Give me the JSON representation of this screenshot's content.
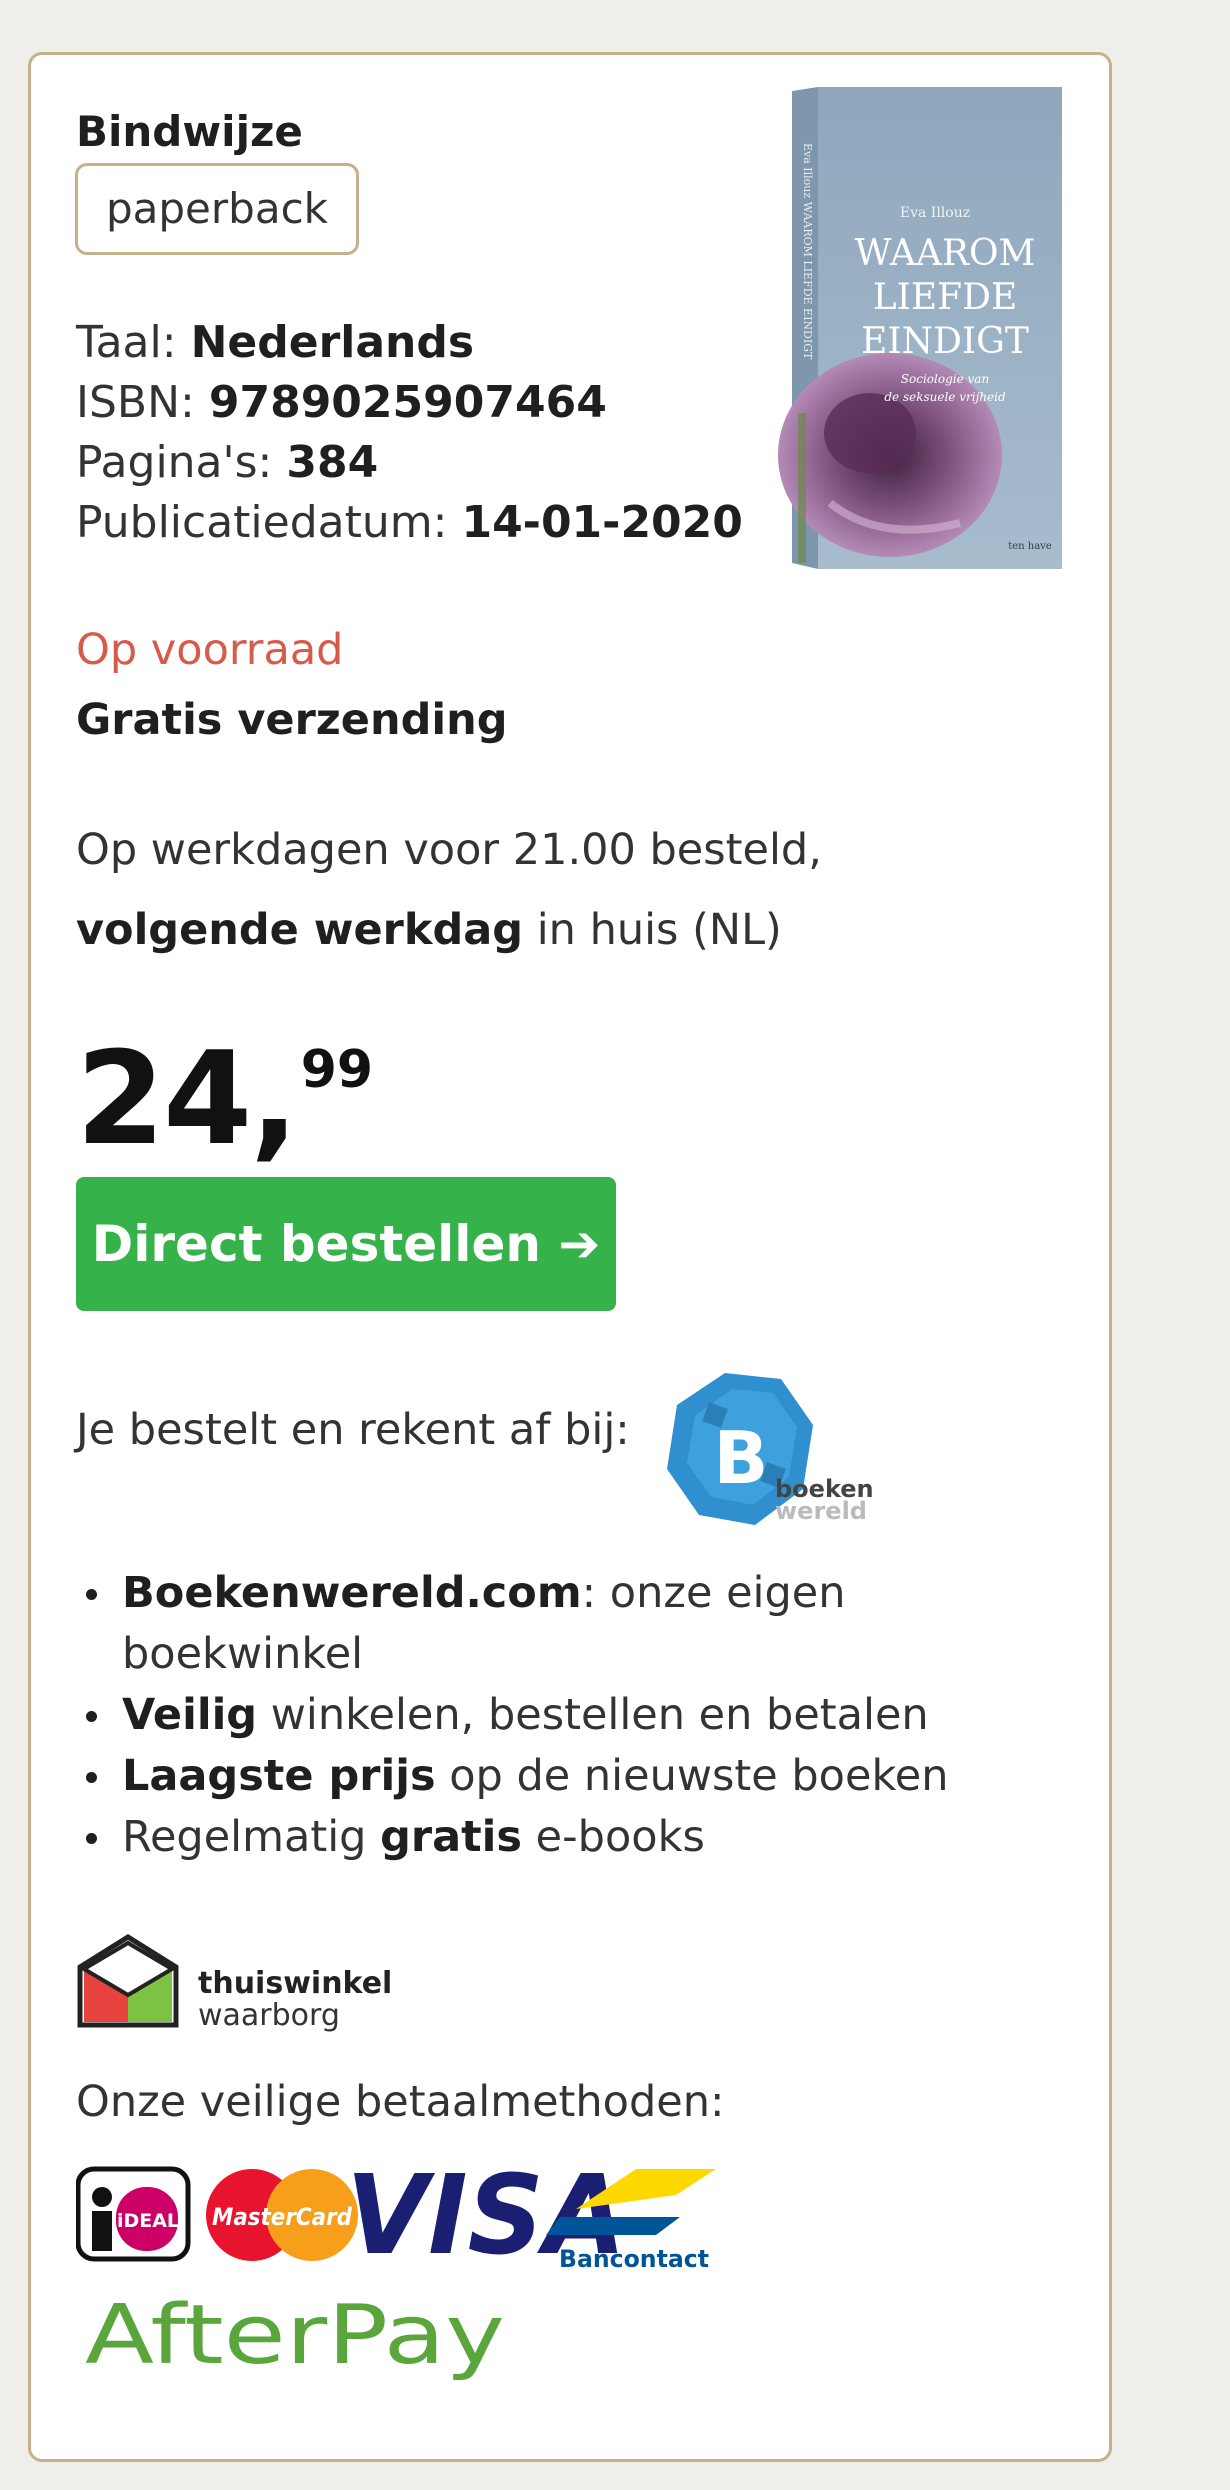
{
  "binding": {
    "heading": "Bindwijze",
    "value": "paperback"
  },
  "meta": {
    "language_label": "Taal:",
    "language": "Nederlands",
    "isbn_label": "ISBN:",
    "isbn": "9789025907464",
    "pages_label": "Pagina's:",
    "pages": "384",
    "date_label": "Publicatiedatum:",
    "date": "14-01-2020"
  },
  "cover": {
    "author": "Eva Illouz",
    "title_lines": [
      "WAAROM",
      "LIEFDE",
      "EINDIGT"
    ],
    "subtitle_lines": [
      "Sociologie van",
      "de seksuele vrijheid"
    ],
    "publisher": "ten have",
    "spine_text": "Eva Illouz  WAAROM LIEFDE EINDIGT"
  },
  "availability": {
    "stock": "Op voorraad",
    "shipping": "Gratis verzending",
    "delivery_line1": "Op werkdagen voor 21.00 besteld,",
    "delivery_bold": "volgende werkdag",
    "delivery_rest": " in huis (NL)"
  },
  "price": {
    "main": "24,",
    "cents": "99"
  },
  "order_button": {
    "label": "Direct bestellen ➔"
  },
  "seller": {
    "intro": "Je bestelt en rekent af bij:",
    "logo_letter": "B",
    "logo_text1": "boeken",
    "logo_text2": "wereld"
  },
  "bullets": [
    {
      "bold": "Boekenwereld.com",
      "rest": ": onze eigen",
      "rest2": "boekwinkel"
    },
    {
      "bold": "Veilig",
      "rest": " winkelen, bestellen en betalen"
    },
    {
      "bold": "Laagste prijs",
      "rest": " op de nieuwste boeken"
    },
    {
      "pre": "Regelmatig ",
      "bold": "gratis",
      "rest": " e-books"
    }
  ],
  "thuiswinkel": {
    "line1": "thuiswinkel",
    "line2": "waarborg"
  },
  "payment": {
    "heading": "Onze veilige betaalmethoden:",
    "ideal": "iDEAL",
    "mastercard": "MasterCard",
    "visa": "VISA",
    "bancontact": "Bancontact",
    "afterpay": "AfterPay"
  },
  "colors": {
    "border": "#c6b08a",
    "stock": "#d65b4a",
    "order_button": "#36b24a",
    "boekenwereld": "#2f8fcf",
    "afterpay_green": "#5aa63c",
    "afterpay_brown": "#5b4b3a"
  }
}
